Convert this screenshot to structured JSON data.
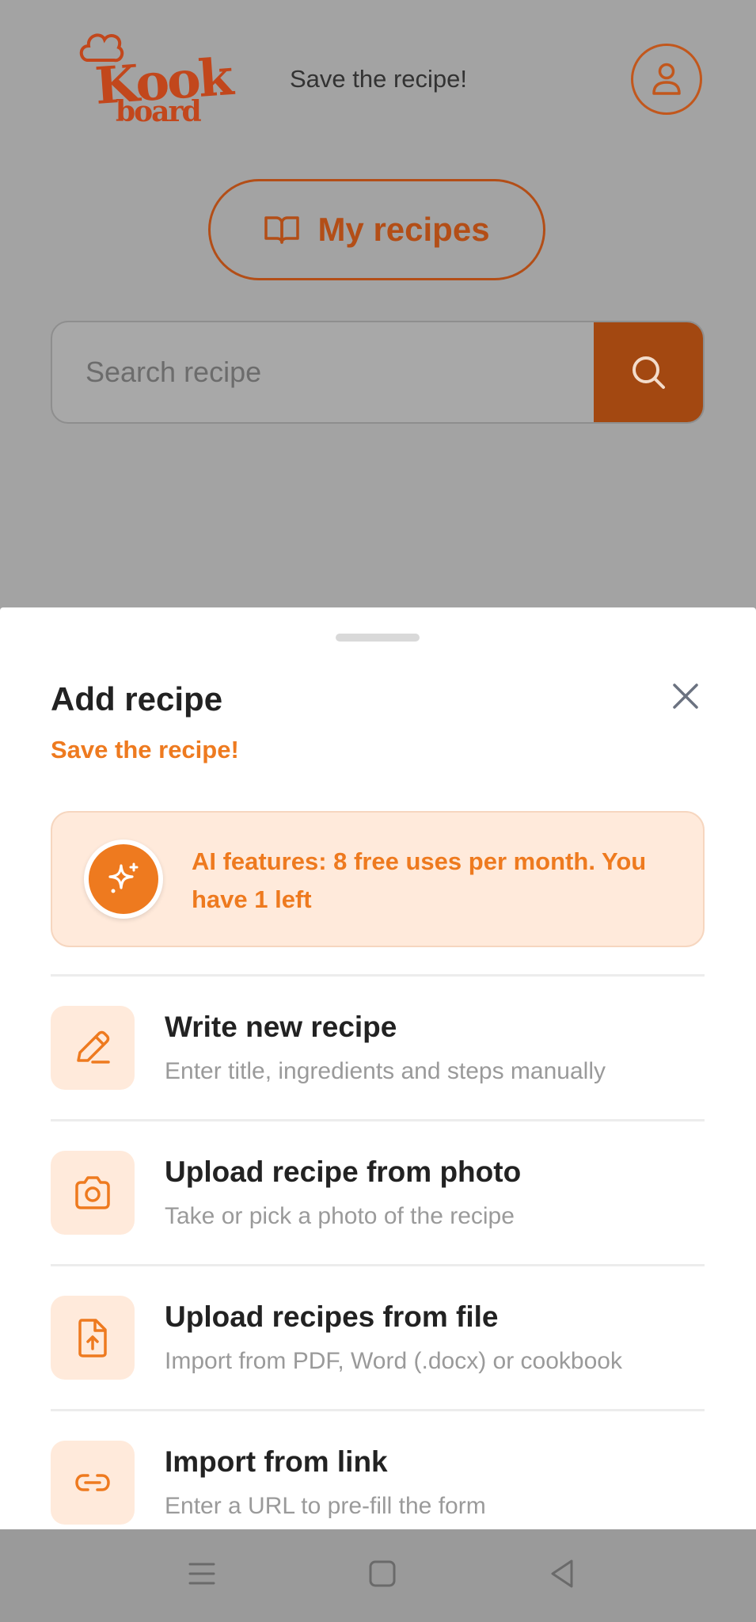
{
  "app": {
    "logo_text_top": "Kook",
    "logo_text_bottom": "board",
    "tagline": "Save the recipe!"
  },
  "header": {
    "my_recipes_label": "My recipes"
  },
  "search": {
    "placeholder": "Search recipe",
    "value": ""
  },
  "sheet": {
    "title": "Add recipe",
    "subtitle": "Save the recipe!",
    "ai_notice": "AI features: 8 free uses per month. You have 1 left",
    "options": [
      {
        "title": "Write new recipe",
        "description": "Enter title, ingredients and steps manually",
        "icon": "pencil-icon"
      },
      {
        "title": "Upload recipe from photo",
        "description": "Take or pick a photo of the recipe",
        "icon": "camera-icon"
      },
      {
        "title": "Upload recipes from file",
        "description": "Import from PDF, Word (.docx) or cookbook",
        "icon": "file-upload-icon"
      },
      {
        "title": "Import from link",
        "description": "Enter a URL to pre-fill the form",
        "icon": "link-icon"
      }
    ]
  },
  "colors": {
    "brand": "#c2471c",
    "accent": "#ee7a1f",
    "accent_soft": "#ffeadb",
    "search_button": "#a34811"
  }
}
